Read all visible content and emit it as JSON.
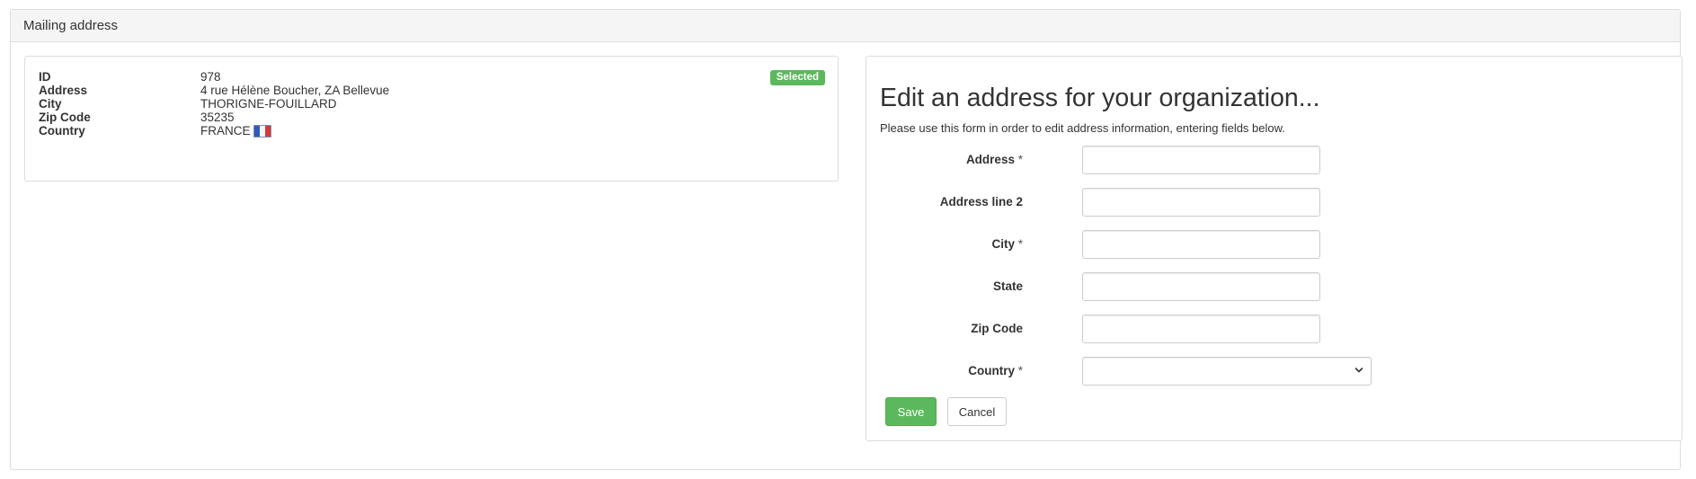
{
  "panel": {
    "title": "Mailing address"
  },
  "address_card": {
    "badge": "Selected",
    "rows": [
      {
        "label": "ID",
        "value": "978"
      },
      {
        "label": "Address",
        "value": "4 rue Hélène Boucher, ZA Bellevue"
      },
      {
        "label": "City",
        "value": "THORIGNE-FOUILLARD"
      },
      {
        "label": "Zip Code",
        "value": "35235"
      },
      {
        "label": "Country",
        "value": "FRANCE"
      }
    ],
    "country_flag_icon": "france-flag-icon"
  },
  "form": {
    "title": "Edit an address for your organization...",
    "subtitle": "Please use this form in order to edit address information, entering fields below.",
    "required_marker": "*",
    "fields": {
      "address": {
        "label": "Address",
        "value": ""
      },
      "address2": {
        "label": "Address line 2",
        "value": ""
      },
      "city": {
        "label": "City",
        "value": ""
      },
      "state": {
        "label": "State",
        "value": ""
      },
      "zip": {
        "label": "Zip Code",
        "value": ""
      },
      "country": {
        "label": "Country",
        "value": ""
      }
    },
    "save_label": "Save",
    "cancel_label": "Cancel"
  },
  "colors": {
    "success": "#5cb85c",
    "border": "#dddddd",
    "heading_bg": "#f5f5f5",
    "text": "#333333"
  }
}
